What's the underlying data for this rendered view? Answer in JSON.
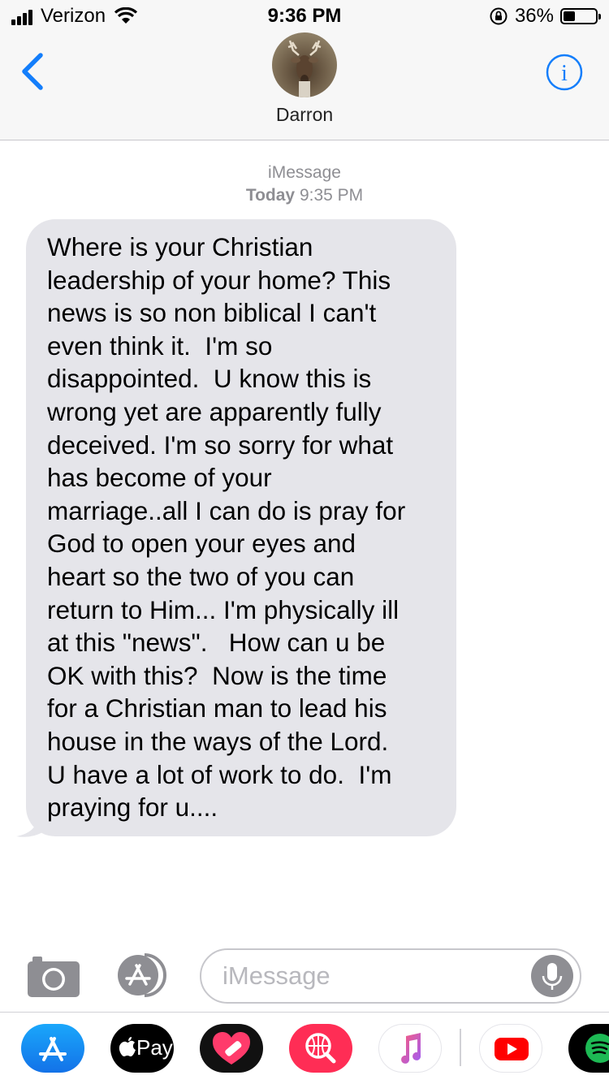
{
  "status_bar": {
    "carrier": "Verizon",
    "time": "9:36 PM",
    "battery_percent": "36%",
    "battery_level": 0.36,
    "signal_bars": 4
  },
  "nav": {
    "contact_name": "Darron",
    "back_icon": "chevron-left-icon",
    "info_icon": "info-icon"
  },
  "thread": {
    "service": "iMessage",
    "day": "Today",
    "time": "9:35 PM"
  },
  "message": {
    "text": "Where is your Christian\nleadership of your home? This\nnews is so non biblical I can't\neven think it.  I'm so\ndisappointed.  U know this is\nwrong yet are apparently fully\ndeceived. I'm so sorry for what\nhas become of your\nmarriage..all I can do is pray for\nGod to open your eyes and\nheart so the two of you can\nreturn to Him... I'm physically ill\nat this \"news\".   How can u be\nOK with this?  Now is the time\nfor a Christian man to lead his\nhouse in the ways of the Lord.\nU have a lot of work to do.  I'm\npraying for u...."
  },
  "composer": {
    "placeholder": "iMessage"
  },
  "drawer": {
    "apple_pay_label": "Pay",
    "apps": [
      "app-store",
      "apple-pay",
      "heart-app",
      "search-web-app",
      "music",
      "youtube",
      "spotify"
    ]
  },
  "colors": {
    "ios_blue": "#147efb",
    "bubble_gray": "#e5e5ea",
    "meta_gray": "#8e8e93"
  }
}
